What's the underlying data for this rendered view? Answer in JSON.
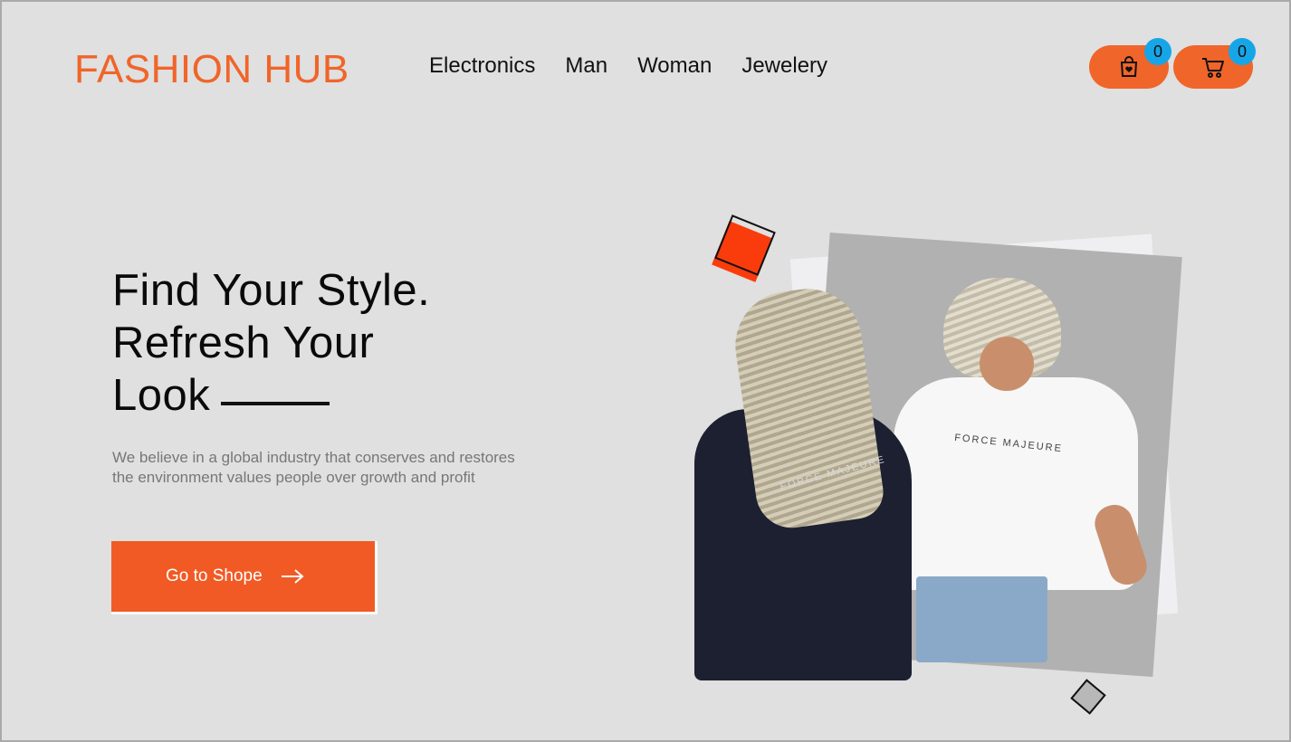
{
  "brand": {
    "logo": "FASHION HUB",
    "accent_color": "#f0652a"
  },
  "nav": {
    "items": [
      {
        "label": "Electronics"
      },
      {
        "label": "Man"
      },
      {
        "label": "Woman"
      },
      {
        "label": "Jewelery"
      }
    ]
  },
  "actions": {
    "wishlist": {
      "icon": "shopping-bag-heart-icon",
      "count": "0"
    },
    "cart": {
      "icon": "shopping-cart-icon",
      "count": "0"
    },
    "badge_color": "#16a6e8"
  },
  "hero": {
    "title_lines": [
      "Find Your Style.",
      "Refresh Your",
      "Look"
    ],
    "description_lines": [
      "We believe in a global industry that conserves and restores",
      "the environment values people over growth and profit"
    ],
    "cta_label": "Go to Shope",
    "cta_icon": "arrow-right-icon",
    "shirt_text_1": "FORCE MAJEURE",
    "shirt_text_2": "FORCE MAJEURE"
  }
}
